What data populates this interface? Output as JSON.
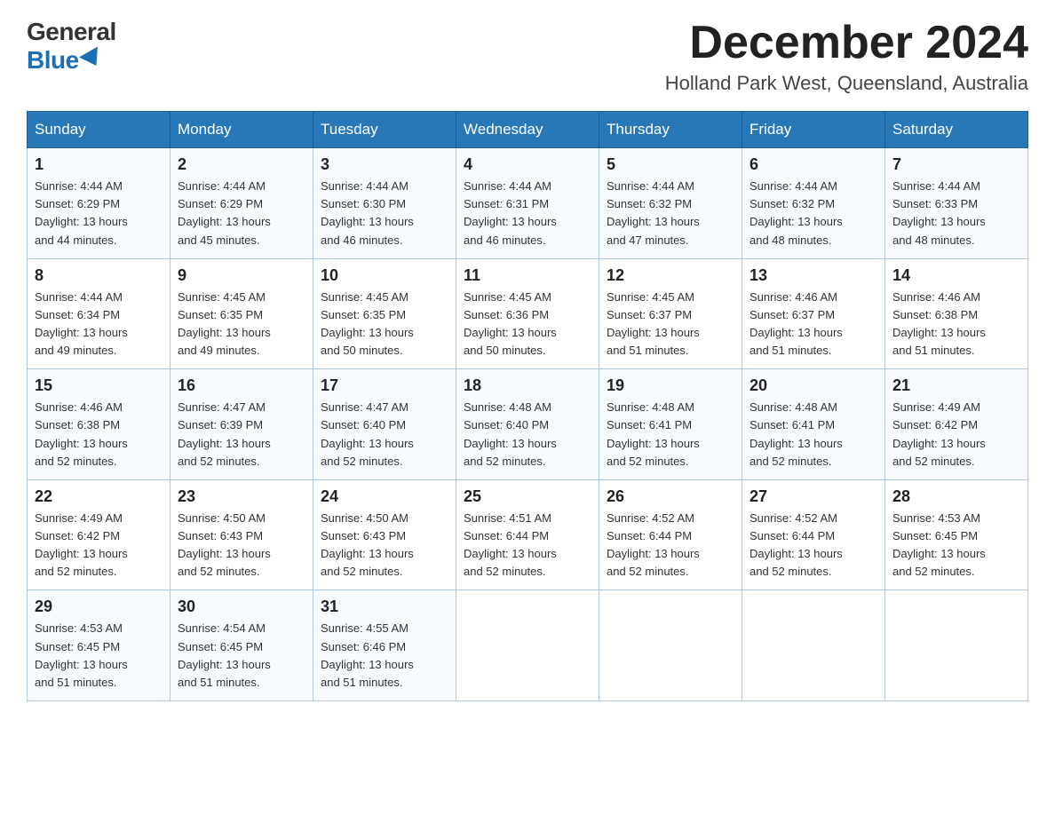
{
  "logo": {
    "general": "General",
    "blue": "Blue"
  },
  "title": "December 2024",
  "subtitle": "Holland Park West, Queensland, Australia",
  "headers": [
    "Sunday",
    "Monday",
    "Tuesday",
    "Wednesday",
    "Thursday",
    "Friday",
    "Saturday"
  ],
  "weeks": [
    [
      {
        "day": "1",
        "sunrise": "4:44 AM",
        "sunset": "6:29 PM",
        "daylight": "13 hours and 44 minutes."
      },
      {
        "day": "2",
        "sunrise": "4:44 AM",
        "sunset": "6:29 PM",
        "daylight": "13 hours and 45 minutes."
      },
      {
        "day": "3",
        "sunrise": "4:44 AM",
        "sunset": "6:30 PM",
        "daylight": "13 hours and 46 minutes."
      },
      {
        "day": "4",
        "sunrise": "4:44 AM",
        "sunset": "6:31 PM",
        "daylight": "13 hours and 46 minutes."
      },
      {
        "day": "5",
        "sunrise": "4:44 AM",
        "sunset": "6:32 PM",
        "daylight": "13 hours and 47 minutes."
      },
      {
        "day": "6",
        "sunrise": "4:44 AM",
        "sunset": "6:32 PM",
        "daylight": "13 hours and 48 minutes."
      },
      {
        "day": "7",
        "sunrise": "4:44 AM",
        "sunset": "6:33 PM",
        "daylight": "13 hours and 48 minutes."
      }
    ],
    [
      {
        "day": "8",
        "sunrise": "4:44 AM",
        "sunset": "6:34 PM",
        "daylight": "13 hours and 49 minutes."
      },
      {
        "day": "9",
        "sunrise": "4:45 AM",
        "sunset": "6:35 PM",
        "daylight": "13 hours and 49 minutes."
      },
      {
        "day": "10",
        "sunrise": "4:45 AM",
        "sunset": "6:35 PM",
        "daylight": "13 hours and 50 minutes."
      },
      {
        "day": "11",
        "sunrise": "4:45 AM",
        "sunset": "6:36 PM",
        "daylight": "13 hours and 50 minutes."
      },
      {
        "day": "12",
        "sunrise": "4:45 AM",
        "sunset": "6:37 PM",
        "daylight": "13 hours and 51 minutes."
      },
      {
        "day": "13",
        "sunrise": "4:46 AM",
        "sunset": "6:37 PM",
        "daylight": "13 hours and 51 minutes."
      },
      {
        "day": "14",
        "sunrise": "4:46 AM",
        "sunset": "6:38 PM",
        "daylight": "13 hours and 51 minutes."
      }
    ],
    [
      {
        "day": "15",
        "sunrise": "4:46 AM",
        "sunset": "6:38 PM",
        "daylight": "13 hours and 52 minutes."
      },
      {
        "day": "16",
        "sunrise": "4:47 AM",
        "sunset": "6:39 PM",
        "daylight": "13 hours and 52 minutes."
      },
      {
        "day": "17",
        "sunrise": "4:47 AM",
        "sunset": "6:40 PM",
        "daylight": "13 hours and 52 minutes."
      },
      {
        "day": "18",
        "sunrise": "4:48 AM",
        "sunset": "6:40 PM",
        "daylight": "13 hours and 52 minutes."
      },
      {
        "day": "19",
        "sunrise": "4:48 AM",
        "sunset": "6:41 PM",
        "daylight": "13 hours and 52 minutes."
      },
      {
        "day": "20",
        "sunrise": "4:48 AM",
        "sunset": "6:41 PM",
        "daylight": "13 hours and 52 minutes."
      },
      {
        "day": "21",
        "sunrise": "4:49 AM",
        "sunset": "6:42 PM",
        "daylight": "13 hours and 52 minutes."
      }
    ],
    [
      {
        "day": "22",
        "sunrise": "4:49 AM",
        "sunset": "6:42 PM",
        "daylight": "13 hours and 52 minutes."
      },
      {
        "day": "23",
        "sunrise": "4:50 AM",
        "sunset": "6:43 PM",
        "daylight": "13 hours and 52 minutes."
      },
      {
        "day": "24",
        "sunrise": "4:50 AM",
        "sunset": "6:43 PM",
        "daylight": "13 hours and 52 minutes."
      },
      {
        "day": "25",
        "sunrise": "4:51 AM",
        "sunset": "6:44 PM",
        "daylight": "13 hours and 52 minutes."
      },
      {
        "day": "26",
        "sunrise": "4:52 AM",
        "sunset": "6:44 PM",
        "daylight": "13 hours and 52 minutes."
      },
      {
        "day": "27",
        "sunrise": "4:52 AM",
        "sunset": "6:44 PM",
        "daylight": "13 hours and 52 minutes."
      },
      {
        "day": "28",
        "sunrise": "4:53 AM",
        "sunset": "6:45 PM",
        "daylight": "13 hours and 52 minutes."
      }
    ],
    [
      {
        "day": "29",
        "sunrise": "4:53 AM",
        "sunset": "6:45 PM",
        "daylight": "13 hours and 51 minutes."
      },
      {
        "day": "30",
        "sunrise": "4:54 AM",
        "sunset": "6:45 PM",
        "daylight": "13 hours and 51 minutes."
      },
      {
        "day": "31",
        "sunrise": "4:55 AM",
        "sunset": "6:46 PM",
        "daylight": "13 hours and 51 minutes."
      },
      null,
      null,
      null,
      null
    ]
  ]
}
